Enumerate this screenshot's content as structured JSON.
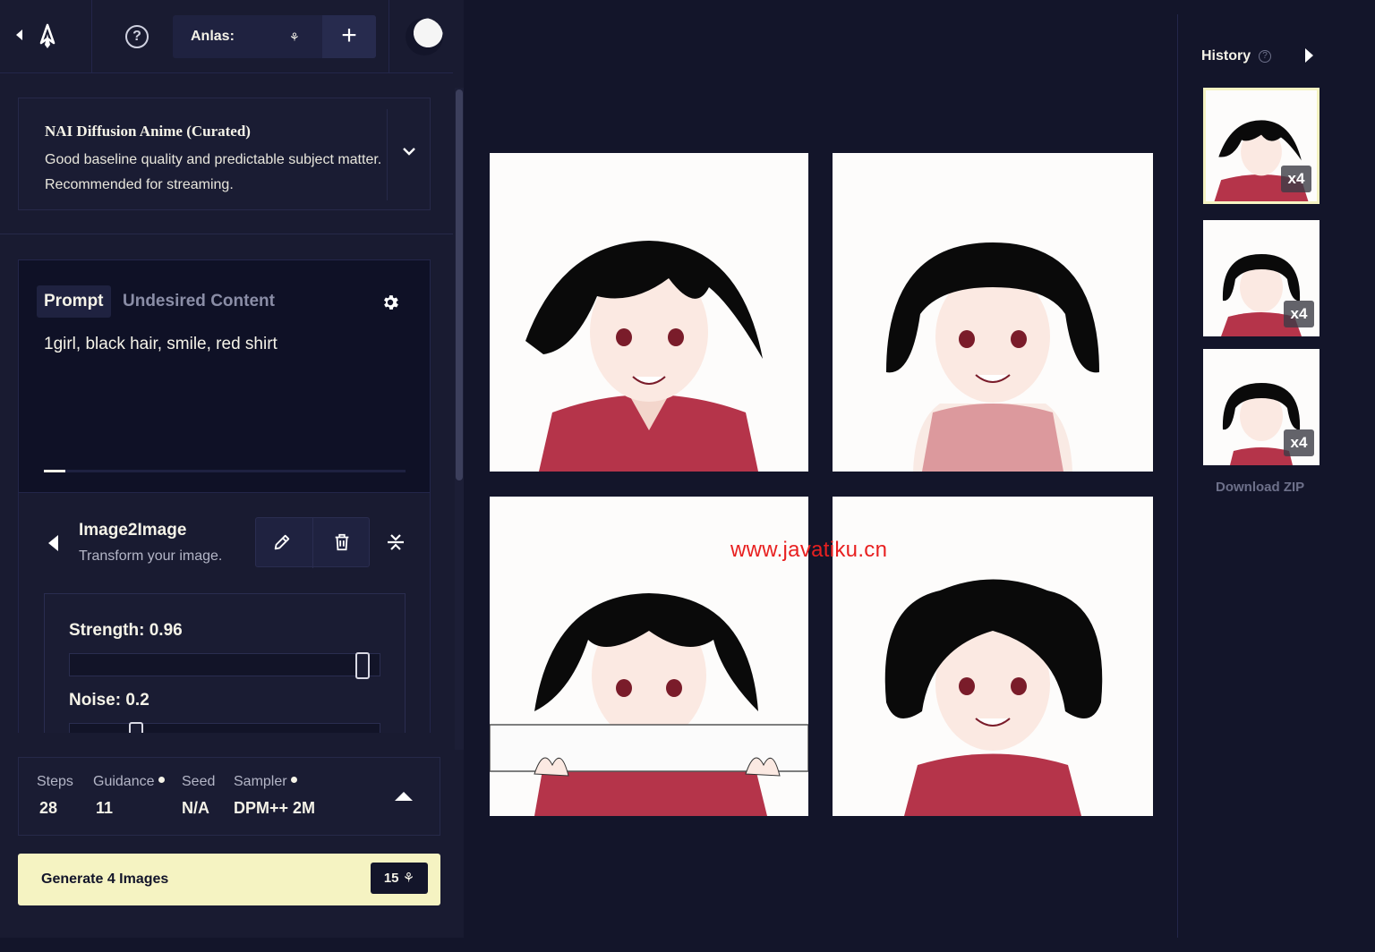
{
  "header": {
    "anlas_label": "Anlas:",
    "help_glyph": "?",
    "plus_glyph": "+"
  },
  "model": {
    "name": "NAI Diffusion Anime (Curated)",
    "description": "Good baseline quality and predictable subject matter. Recommended for streaming."
  },
  "prompt": {
    "tabs": [
      "Prompt",
      "Undesired Content"
    ],
    "active_tab": "Prompt",
    "text": "1girl, black hair, smile, red shirt",
    "token_fill_fraction": 0.06
  },
  "image2image": {
    "title": "Image2Image",
    "subtitle": "Transform your image.",
    "strength_label": "Strength:",
    "strength_value": "0.96",
    "noise_label": "Noise:",
    "noise_value": "0.2",
    "strength_fraction": 0.96,
    "noise_fraction": 0.2
  },
  "settings": {
    "steps_label": "Steps",
    "steps_value": "28",
    "guidance_label": "Guidance",
    "guidance_value": "11",
    "seed_label": "Seed",
    "seed_value": "N/A",
    "sampler_label": "Sampler",
    "sampler_value": "DPM++ 2M"
  },
  "generate": {
    "label": "Generate 4 Images",
    "cost": "15"
  },
  "gallery": {
    "shirt_color": "#b5344a",
    "hair_color": "#0a0a0a"
  },
  "history": {
    "title": "History",
    "help_glyph": "?",
    "items": [
      {
        "badge": "x4"
      },
      {
        "badge": "x4"
      },
      {
        "badge": "x4"
      }
    ],
    "download_label": "Download ZIP"
  },
  "watermark": "www.javatiku.cn",
  "colors": {
    "background": "#13152a",
    "panel": "#191b31",
    "accent": "#f5f3c2",
    "text": "#f5f3e8"
  }
}
